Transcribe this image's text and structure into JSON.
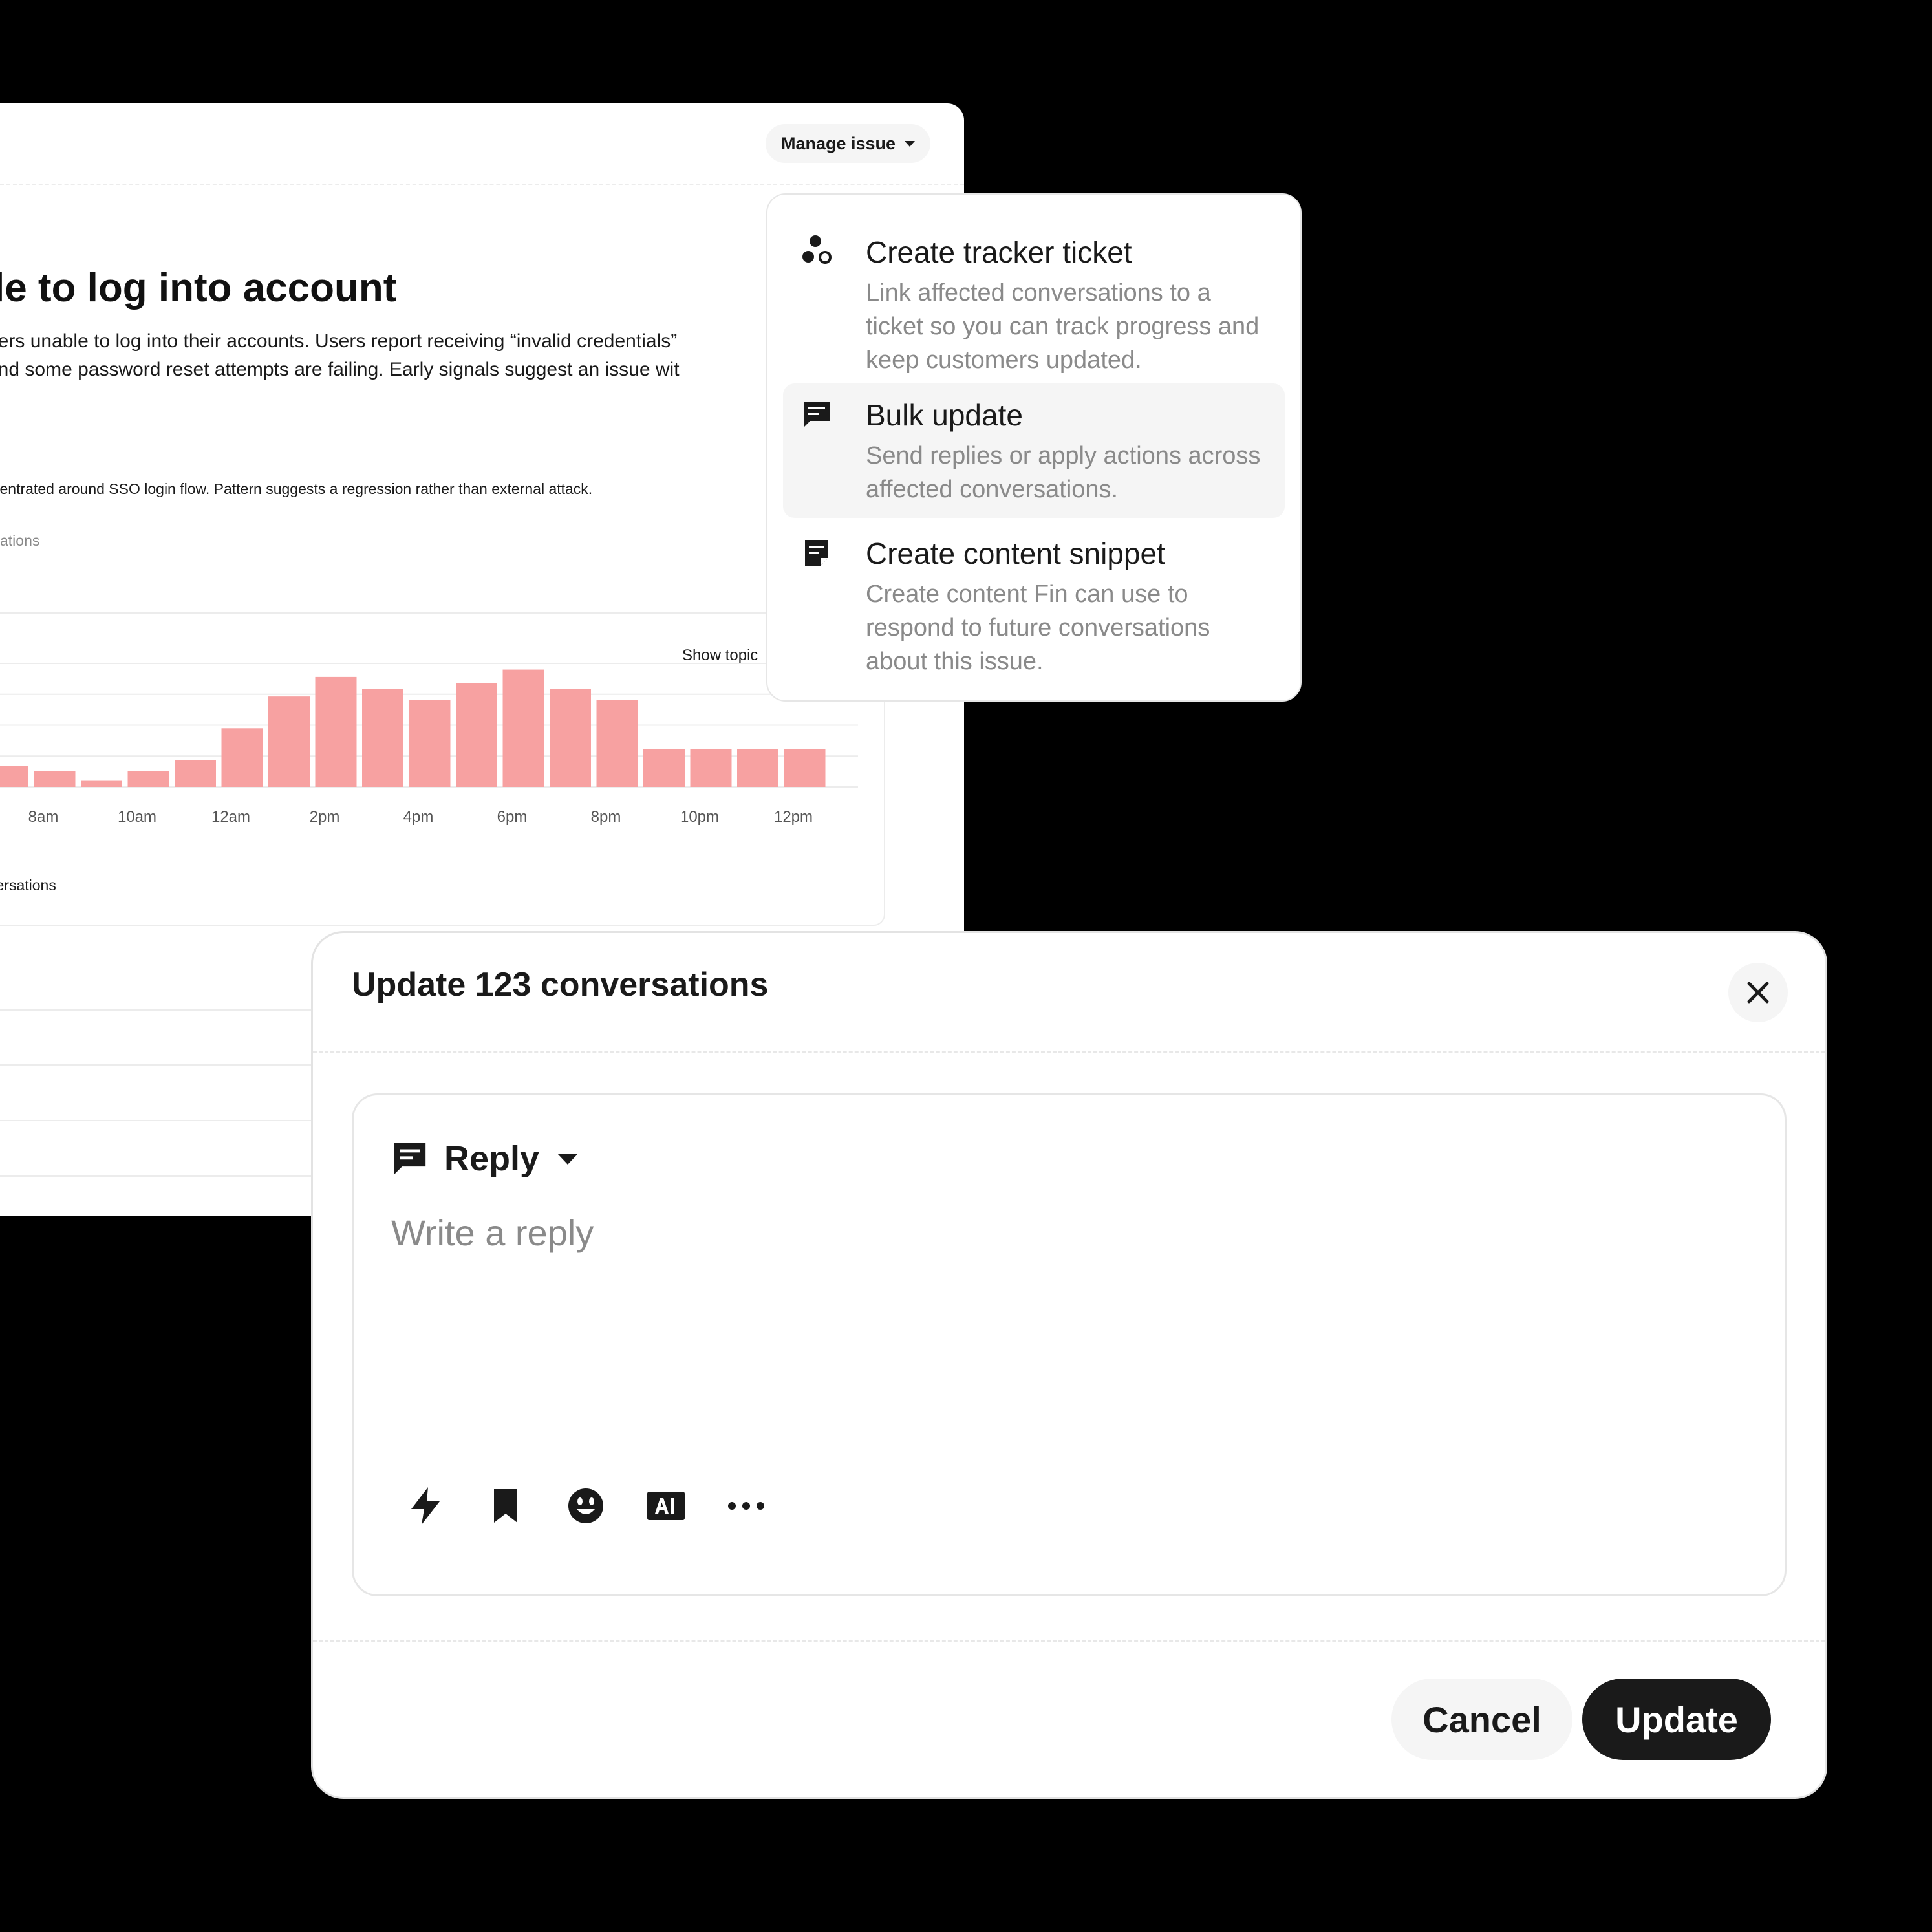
{
  "issue": {
    "manage_label": "Manage issue",
    "title": "le to log into account",
    "description": "ners unable to log into their accounts. Users report receiving “invalid credentials”\n and some password reset attempts are failing. Early signals suggest an issue wit",
    "note": "centrated around SSO login flow. Pattern suggests a regression rather than external attack.",
    "sub_label": "ations",
    "show_topic_label": "Show topic",
    "chart_legend": "versations"
  },
  "chart_data": {
    "type": "bar",
    "values": [
      8.5,
      6.5,
      2.5,
      6.5,
      11,
      24,
      37,
      45,
      40,
      35.5,
      42.5,
      48,
      40,
      35.5,
      15.5,
      15.5,
      15.5,
      15.5
    ],
    "x_tick_labels": [
      "8am",
      "10am",
      "12am",
      "2pm",
      "4pm",
      "6pm",
      "8pm",
      "10pm",
      "12pm"
    ],
    "ylim": [
      0,
      50
    ],
    "grid": true,
    "bar_color": "#f7a1a1"
  },
  "menu": {
    "items": [
      {
        "title": "Create tracker ticket",
        "desc": "Link affected conversations to a ticket so you can track progress and keep customers updated.",
        "icon": "tracker-icon"
      },
      {
        "title": "Bulk update",
        "desc": "Send replies or apply actions across affected conversations.",
        "icon": "chat-icon"
      },
      {
        "title": "Create content snippet",
        "desc": "Create content Fin can use to respond to future conversations about this issue.",
        "icon": "snippet-icon"
      }
    ]
  },
  "modal": {
    "title": "Update 123 conversations",
    "reply_label": "Reply",
    "reply_placeholder": "Write a reply",
    "tools": [
      "lightning-icon",
      "bookmark-icon",
      "emoji-icon",
      "ai-icon",
      "more-icon"
    ],
    "cancel_label": "Cancel",
    "update_label": "Update"
  },
  "colors": {
    "accent_dark": "#1a1a1a",
    "muted_text": "#8a8a8a",
    "bar": "#f7a1a1",
    "page_background": "#000000"
  }
}
